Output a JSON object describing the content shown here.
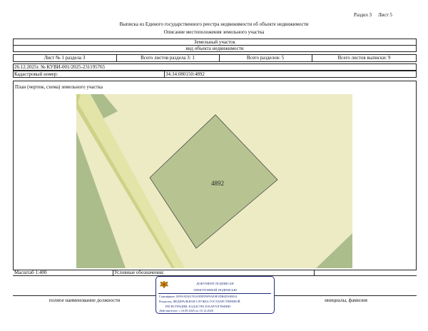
{
  "header": {
    "section": "Раздел 3",
    "sheet": "Лист 5",
    "title": "Выписка из Единого государственного реестра недвижимости об объекте недвижимости",
    "subtitle": "Описание местоположения земельного участка"
  },
  "object": {
    "name": "Земельный участок",
    "kind": "вид объекта недвижимости"
  },
  "sheet_info": {
    "sheet_of_section": "Лист № 1 раздела 3",
    "total_sheets_section": "Всего листов раздела 3: 1",
    "total_sections": "Всего разделов: 5",
    "total_sheets_extract": "Всего листов выписки: 9"
  },
  "document": {
    "date_number": "26.12.2025г. № КУВИ-001/2025-231195765",
    "cadastral_label": "Кадастровый номер:",
    "cadastral_value": "34:34:080150:4892"
  },
  "plan": {
    "caption": "План (чертеж, схема) земельного участка",
    "parcel_label": "4892",
    "colors": {
      "background": "#ecebc4",
      "parcel": "#b7c491",
      "road": "#e3e4a8",
      "road_edge": "#ccd287",
      "neighbor": "#acbd8c"
    }
  },
  "footer": {
    "scale": "Масштаб 1:400",
    "legend": "Условные обозначения:",
    "position": "полное наименование должности",
    "initials": "инициалы, фамилия"
  },
  "signature": {
    "line1": "ДОКУМЕНТ ПОДПИСАН",
    "line2": "ЭЛЕКТРОННОЙ ПОДПИСЬЮ",
    "cert": "Сертификат: 00FAAD4A763A9DFD9F9AE8F2DB4E56E00A",
    "owner_1": "Владелец: ФЕДЕРАЛЬНАЯ СЛУЖБА ГОСУДАРСТВЕННОЙ",
    "owner_2": "РЕГИСТРАЦИИ, КАДАСТРА И КАРТОГРАФИИ",
    "valid": "Действителен: с 16.09.2025 по 10.12.2026",
    "emblem": "eagle-emblem-icon",
    "color": "#1f2e7a"
  }
}
